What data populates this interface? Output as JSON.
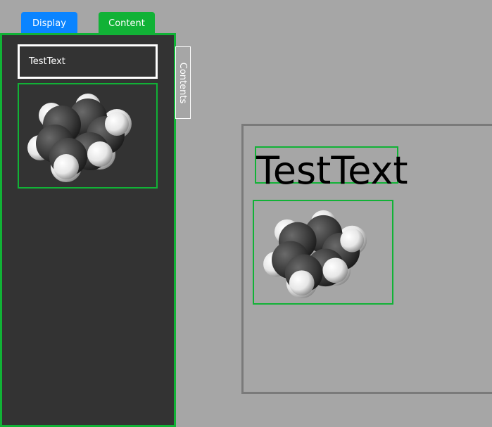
{
  "tabs": {
    "display_label": "Display",
    "content_label": "Content"
  },
  "panel": {
    "text_item": "TestText",
    "image_item": "benzene-space-filling-molecule"
  },
  "side_tab": {
    "label": "Contents"
  },
  "canvas": {
    "text": "TestText",
    "image": "benzene-space-filling-molecule"
  },
  "colors": {
    "background": "#a6a6a6",
    "panel": "#333333",
    "accent_green": "#11b236",
    "accent_blue": "#0a84ff",
    "canvas_border": "#7a7a7a"
  }
}
